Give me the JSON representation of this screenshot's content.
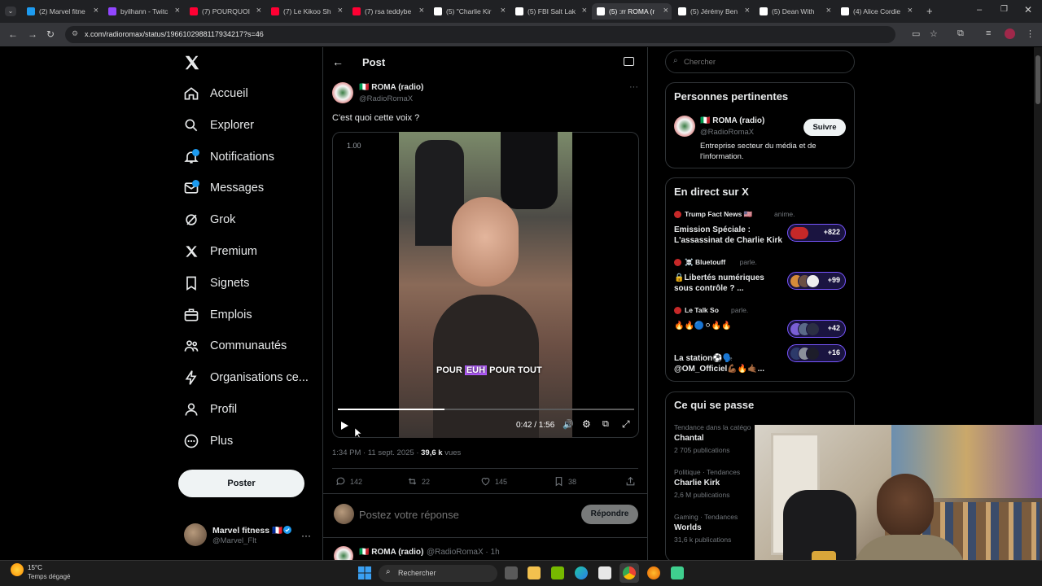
{
  "browser": {
    "tabs": [
      {
        "title": "(2) Marvel fitne",
        "color": "#1d9bf0"
      },
      {
        "title": "byilhann - Twitc",
        "color": "#9146ff"
      },
      {
        "title": "(7) POURQUOI",
        "color": "#ff0033"
      },
      {
        "title": "(7) Le Kikoo Sh",
        "color": "#ff0033"
      },
      {
        "title": "(7) rsa teddybe",
        "color": "#ff0033"
      },
      {
        "title": "(5) \"Charlie Kir",
        "color": "#ffffff"
      },
      {
        "title": "(5) FBI Salt Lak",
        "color": "#ffffff"
      },
      {
        "title": "(5) :rr ROMA (r",
        "color": "#ffffff"
      },
      {
        "title": "(5) Jérémy Ben",
        "color": "#ffffff"
      },
      {
        "title": "(5) Dean With",
        "color": "#ffffff"
      },
      {
        "title": "(4) Alice Cordie",
        "color": "#ffffff"
      }
    ],
    "url": "x.com/radioromax/status/1966102988117934217?s=46"
  },
  "nav": {
    "items": [
      {
        "label": "Accueil",
        "icon": "home-icon"
      },
      {
        "label": "Explorer",
        "icon": "search-icon"
      },
      {
        "label": "Notifications",
        "icon": "bell-icon"
      },
      {
        "label": "Messages",
        "icon": "mail-icon"
      },
      {
        "label": "Grok",
        "icon": "grok-icon"
      },
      {
        "label": "Premium",
        "icon": "x-logo-icon"
      },
      {
        "label": "Signets",
        "icon": "bookmark-icon"
      },
      {
        "label": "Emplois",
        "icon": "briefcase-icon"
      },
      {
        "label": "Communautés",
        "icon": "people-icon"
      },
      {
        "label": "Organisations ce...",
        "icon": "bolt-icon"
      },
      {
        "label": "Profil",
        "icon": "person-icon"
      },
      {
        "label": "Plus",
        "icon": "more-circle-icon"
      }
    ],
    "post_button": "Poster",
    "account": {
      "name": "Marvel fitness 🇫🇷",
      "handle": "@Marvel_Flt"
    }
  },
  "post": {
    "header": "Post",
    "author_name": "🇮🇹 ROMA (radio)",
    "author_handle": "@RadioRomaX",
    "text": "C'est quoi cette voix ?",
    "video": {
      "speed": "1.00",
      "caption_before": "POUR ",
      "caption_highlight": "EUH",
      "caption_after": " POUR TOUT",
      "time": "0:42 / 1:56",
      "progress": 0.36
    },
    "meta_time": "1:34 PM · 11 sept. 2025 · ",
    "views_count": "39,6 k",
    "views_label": " vues",
    "stats": {
      "replies": "142",
      "reposts": "22",
      "likes": "145",
      "bookmarks": "38"
    },
    "reply_placeholder": "Postez votre réponse",
    "reply_button": "Répondre",
    "next_reply": {
      "name": "🇮🇹 ROMA (radio)",
      "handle": "@RadioRomaX · 1h"
    }
  },
  "right": {
    "search_placeholder": "Chercher",
    "relevant": {
      "title": "Personnes pertinentes",
      "name": "🇮🇹 ROMA (radio)",
      "handle": "@RadioRomaX",
      "follow": "Suivre",
      "bio": "Entreprise secteur du média et de l'information."
    },
    "live": {
      "title": "En direct sur X",
      "items": [
        {
          "host": "Trump Fact News 🇺🇸",
          "verb": "anime.",
          "title": "Emission Spéciale : L'assassinat de Charlie Kirk",
          "count": "+822"
        },
        {
          "host": "☠️ Bluetouff",
          "verb": "parle.",
          "title": "🔒Libertés numériques sous contrôle ? ...",
          "count": "+99"
        },
        {
          "host": "Le Talk So",
          "verb": "parle.",
          "title": "🔥🔥🔵⚪🔥🔥",
          "count": "+42"
        },
        {
          "host": "",
          "verb": "",
          "title": "La station⚽🗣️ @OM_Officiel💪🏾🔥🤙🏾...",
          "count": "+16"
        }
      ]
    },
    "trends": {
      "title": "Ce qui se passe",
      "items": [
        {
          "label": "Tendance dans la catégo",
          "name": "Chantal",
          "count": "2 705 publications"
        },
        {
          "label": "Politique · Tendances",
          "name": "Charlie Kirk",
          "count": "2,6 M publications"
        },
        {
          "label": "Gaming · Tendances",
          "name": "Worlds",
          "count": "31,6 k publications"
        }
      ]
    }
  },
  "taskbar": {
    "temp": "15°C",
    "weather": "Temps dégagé",
    "search": "Rechercher"
  },
  "colors": {
    "accent": "#1d9bf0",
    "live": "#7856ff",
    "bg": "#000000"
  }
}
